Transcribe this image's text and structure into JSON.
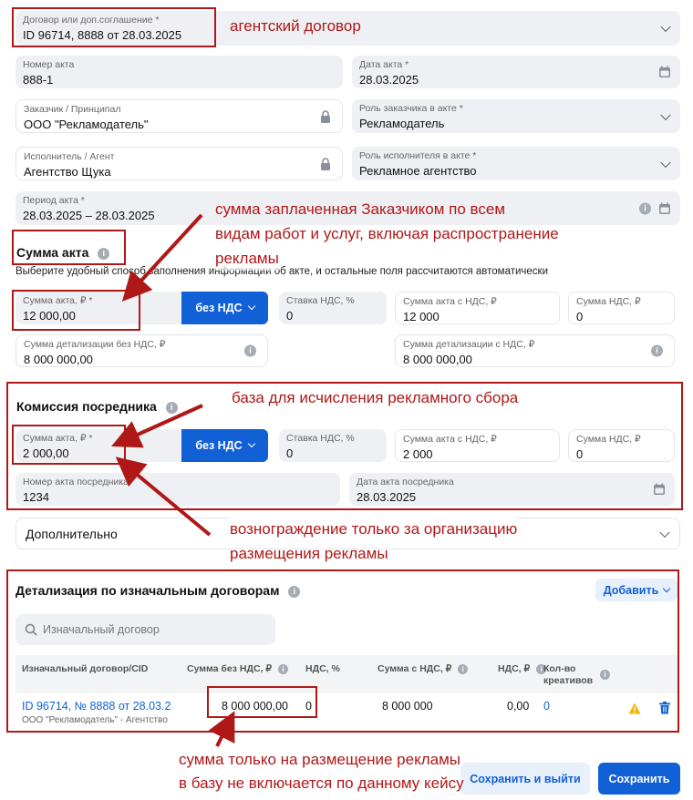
{
  "contract": {
    "label": "Договор или доп.соглашение *",
    "value": "ID 96714, 8888 от 28.03.2025"
  },
  "act_number": {
    "label": "Номер акта",
    "value": "888-1"
  },
  "act_date": {
    "label": "Дата акта *",
    "value": "28.03.2025"
  },
  "customer": {
    "label": "Заказчик / Принципал",
    "value": "ООО \"Рекламодатель\""
  },
  "customer_role": {
    "label": "Роль заказчика в акте *",
    "value": "Рекламодатель"
  },
  "executor": {
    "label": "Исполнитель / Агент",
    "value": "Агентство Щука"
  },
  "executor_role": {
    "label": "Роль исполнителя в акте *",
    "value": "Рекламное агентство"
  },
  "period": {
    "label": "Период акта *",
    "value": "28.03.2025 – 28.03.2025"
  },
  "act_sum_section": {
    "title": "Сумма акта",
    "subtitle": "Выберите удобный способ заполнения информации об акте, и остальные поля рассчитаются автоматически",
    "sum_label": "Сумма акта, ₽ *",
    "sum_value": "12 000,00",
    "vat_button": "без НДС",
    "rate_label": "Ставка НДС, %",
    "rate_value": "0",
    "sum_with_vat_label": "Сумма акта с НДС, ₽",
    "sum_with_vat_value": "12 000",
    "vat_sum_label": "Сумма НДС, ₽",
    "vat_sum_value": "0",
    "detail_novat_label": "Сумма детализации без НДС, ₽",
    "detail_novat_value": "8 000 000,00",
    "detail_vat_label": "Сумма детализации с НДС, ₽",
    "detail_vat_value": "8 000 000,00"
  },
  "commission": {
    "title": "Комиссия посредника",
    "sum_label": "Сумма акта, ₽ *",
    "sum_value": "2 000,00",
    "vat_button": "без НДС",
    "rate_label": "Ставка НДС, %",
    "rate_value": "0",
    "sum_with_vat_label": "Сумма акта с НДС, ₽",
    "sum_with_vat_value": "2 000",
    "vat_sum_label": "Сумма НДС, ₽",
    "vat_sum_value": "0",
    "act_no_label": "Номер акта посредника",
    "act_no_value": "1234",
    "act_date_label": "Дата акта посредника",
    "act_date_value": "28.03.2025"
  },
  "additional": {
    "label": "Дополнительно"
  },
  "details": {
    "title": "Детализация по изначальным договорам",
    "add_button": "Добавить",
    "search_placeholder": "Изначальный договор",
    "columns": {
      "contract": "Изначальный договор/CID",
      "sum_novat": "Сумма без НДС, ₽",
      "vat": "НДС, %",
      "sum_vat": "Сумма с НДС, ₽",
      "vat_sum": "НДС, ₽",
      "creatives": "Кол-во креативов"
    },
    "rows": [
      {
        "contract": "ID 96714, № 8888 от 28.03.2",
        "party": "ООО \"Рекламодатель\" - Агентство",
        "sum_novat": "8 000 000,00",
        "vat": "0",
        "sum_vat": "8 000 000",
        "vat_sum": "0,00",
        "creatives": "0"
      }
    ]
  },
  "footer": {
    "save_exit": "Сохранить и выйти",
    "save": "Сохранить"
  },
  "annotations": {
    "a1": "агентский договор",
    "a2_1": "сумма заплаченная Заказчиком по всем",
    "a2_2": "видам работ и услуг, включая распространение",
    "a2_3": "рекламы",
    "a3": "база для исчисления рекламного сбора",
    "a4_1": "вознограждение только за организацию",
    "a4_2": "размещения рекламы",
    "a5_1": "сумма только на размещение рекламы",
    "a5_2": "в базу не включается по данному кейсу"
  },
  "colors": {
    "accent": "#1260d6",
    "annotation": "#b01818",
    "field_bg": "#eef0f3",
    "warning": "#f2b600"
  }
}
